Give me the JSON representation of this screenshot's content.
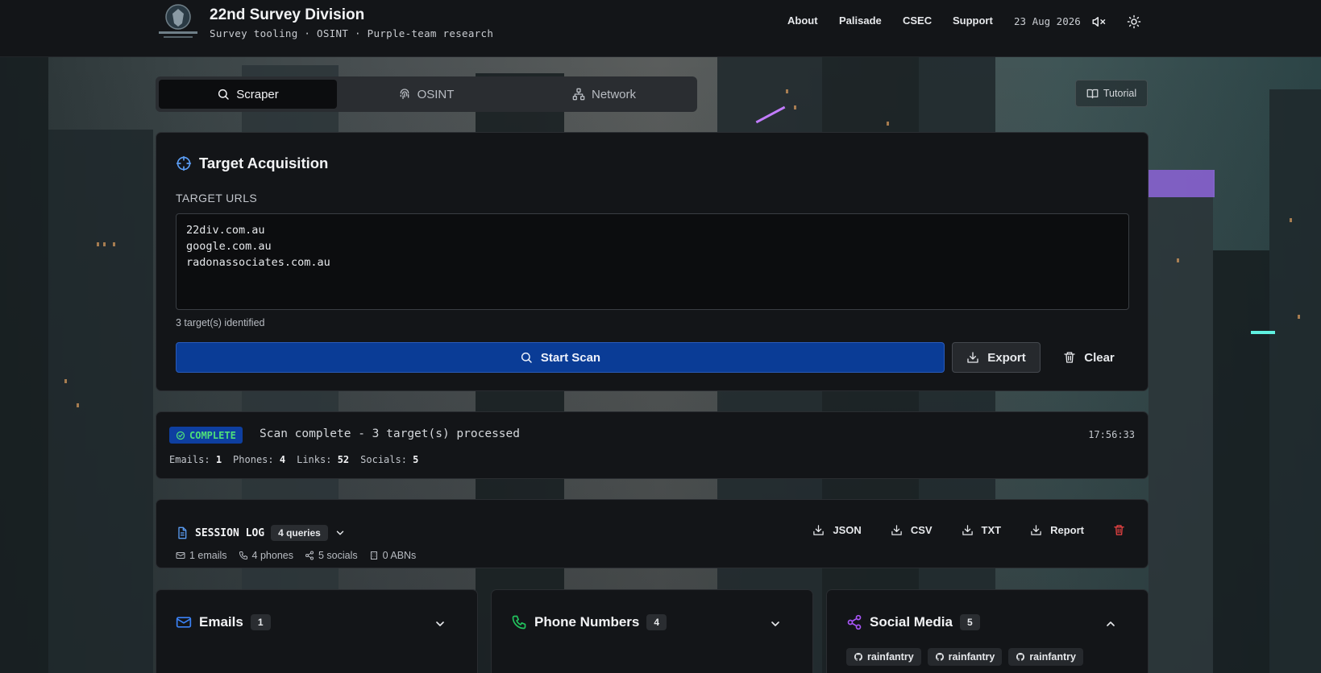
{
  "brand": {
    "title": "22nd Survey Division",
    "subtitle": "Survey tooling · OSINT · Purple-team research"
  },
  "nav": {
    "links": [
      "About",
      "Palisade",
      "CSEC",
      "Support"
    ],
    "date": "23 Aug 2026",
    "icons": [
      "mute-icon",
      "sun-icon"
    ]
  },
  "tabs": [
    {
      "label": "Scraper",
      "icon": "search-icon",
      "active": true
    },
    {
      "label": "OSINT",
      "icon": "fingerprint-icon",
      "active": false
    },
    {
      "label": "Network",
      "icon": "network-icon",
      "active": false
    }
  ],
  "tutorial_label": "Tutorial",
  "target": {
    "title": "Target Acquisition",
    "field_label": "TARGET URLS",
    "urls_value": "22div.com.au\ngoogle.com.au\nradonassociates.com.au",
    "count_note": "3 target(s) identified",
    "scan_label": "Start Scan",
    "export_label": "Export",
    "clear_label": "Clear"
  },
  "status": {
    "badge": "COMPLETE",
    "message": "Scan complete - 3 target(s) processed",
    "time": "17:56:33",
    "stats": {
      "emails_label": "Emails:",
      "emails": "1",
      "phones_label": "Phones:",
      "phones": "4",
      "links_label": "Links:",
      "links": "52",
      "socials_label": "Socials:",
      "socials": "5"
    }
  },
  "session": {
    "title": "SESSION LOG",
    "queries": "4 queries",
    "meta": {
      "emails": "1 emails",
      "phones": "4 phones",
      "socials": "5 socials",
      "abns": "0 ABNs"
    },
    "actions": [
      "JSON",
      "CSV",
      "TXT",
      "Report"
    ]
  },
  "panels": [
    {
      "title": "Emails",
      "count": "1",
      "expanded": false
    },
    {
      "title": "Phone Numbers",
      "count": "4",
      "expanded": false
    },
    {
      "title": "Social Media",
      "count": "5",
      "expanded": true
    }
  ],
  "social_chips": [
    "rainfantry",
    "rainfantry",
    "rainfantry"
  ],
  "colors": {
    "accent_blue": "#0a3c96",
    "complete_green": "#4ee07a",
    "email_icon": "#3b82f6",
    "phone_icon": "#22c55e",
    "social_icon": "#a855f7",
    "danger": "#ef4444"
  }
}
